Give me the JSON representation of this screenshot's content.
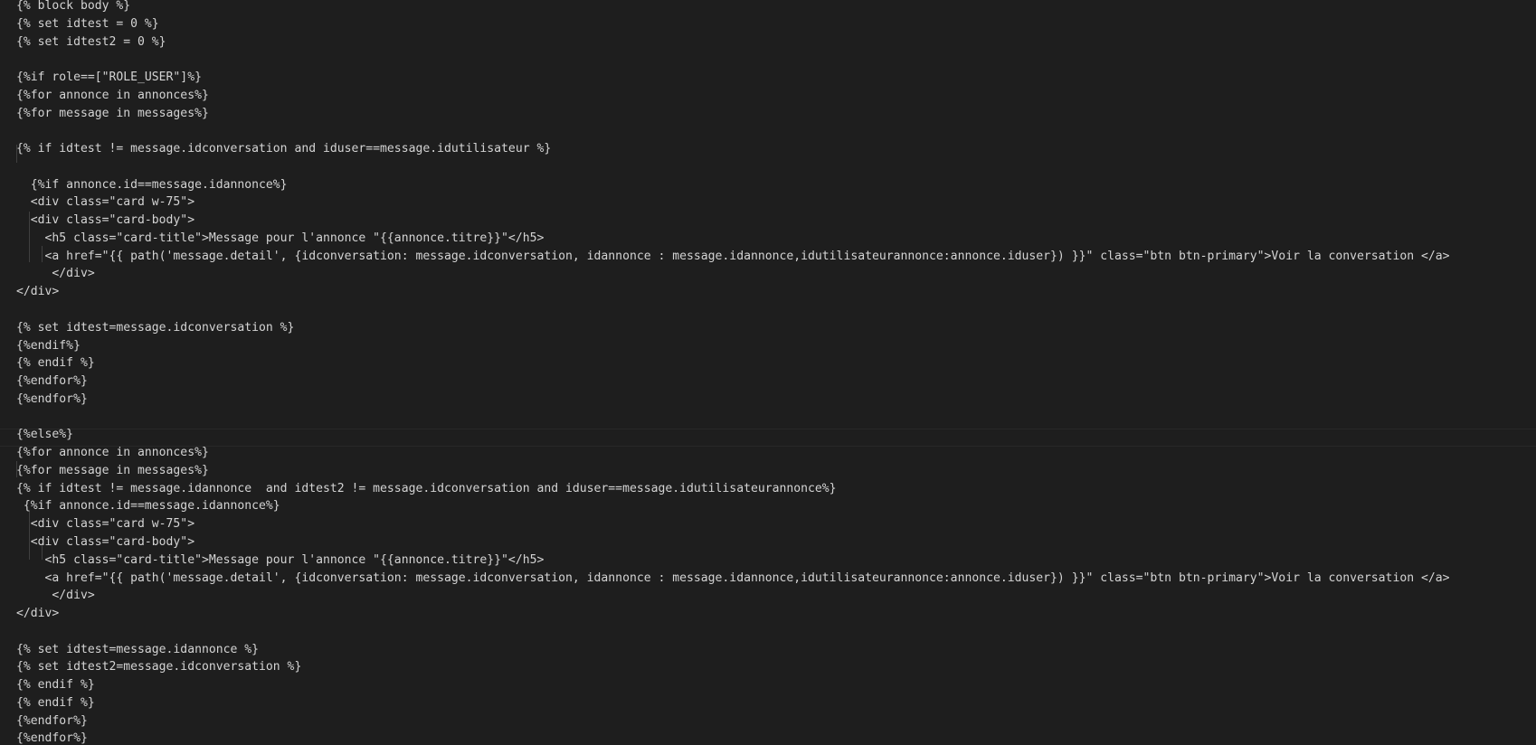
{
  "editor": {
    "lines": [
      "{% block body %}",
      "{% set idtest = 0 %}",
      "{% set idtest2 = 0 %}",
      "",
      "{%if role==[\"ROLE_USER\"]%}",
      "{%for annonce in annonces%}",
      "{%for message in messages%}",
      "",
      "{% if idtest != message.idconversation and iduser==message.idutilisateur %}",
      "",
      "  {%if annonce.id==message.idannonce%}",
      "  <div class=\"card w-75\">",
      "  <div class=\"card-body\">",
      "    <h5 class=\"card-title\">Message pour l'annonce \"{{annonce.titre}}\"</h5>",
      "    <a href=\"{{ path('message.detail', {idconversation: message.idconversation, idannonce : message.idannonce,idutilisateurannonce:annonce.iduser}) }}\" class=\"btn btn-primary\">Voir la conversation </a>",
      "     </div>",
      "</div>",
      "",
      "{% set idtest=message.idconversation %}",
      "{%endif%}",
      "{% endif %}",
      "{%endfor%}",
      "{%endfor%}",
      "",
      "{%else%}",
      "{%for annonce in annonces%}",
      "{%for message in messages%}",
      "{% if idtest != message.idannonce  and idtest2 != message.idconversation and iduser==message.idutilisateurannonce%}",
      " {%if annonce.id==message.idannonce%}",
      "  <div class=\"card w-75\">",
      "  <div class=\"card-body\">",
      "    <h5 class=\"card-title\">Message pour l'annonce \"{{annonce.titre}}\"</h5>",
      "    <a href=\"{{ path('message.detail', {idconversation: message.idconversation, idannonce : message.idannonce,idutilisateurannonce:annonce.iduser}) }}\" class=\"btn btn-primary\">Voir la conversation </a>",
      "     </div>",
      "</div>",
      "",
      "{% set idtest=message.idannonce %}",
      "{% set idtest2=message.idconversation %}",
      "{% endif %}",
      "{% endif %}",
      "{%endfor%}",
      "{%endfor%}"
    ]
  },
  "colors": {
    "background": "#1e1e1e",
    "text": "#d4d4d4",
    "indent_guide": "#404040"
  }
}
